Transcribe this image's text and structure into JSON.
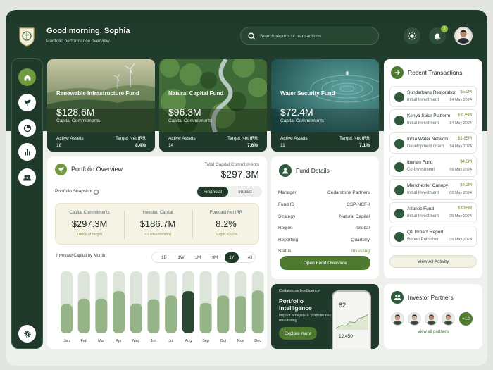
{
  "header": {
    "greeting": "Good morning, Sophia",
    "subtitle": "Portfolio performance overview",
    "search_placeholder": "Search reports or transactions",
    "notification_count": "2"
  },
  "funds": [
    {
      "title": "Renewable Infrastructure Fund",
      "amount": "$128.6M",
      "caption": "Capital Commitments",
      "assets_label": "Active Assets",
      "assets": "18",
      "irr_label": "Target Net IRR",
      "irr": "8.4%"
    },
    {
      "title": "Natural Capital Fund",
      "amount": "$96.3M",
      "caption": "Capital Commitments",
      "assets_label": "Active Assets",
      "assets": "14",
      "irr_label": "Target Net IRR",
      "irr": "7.6%"
    },
    {
      "title": "Water Security Fund",
      "amount": "$72.4M",
      "caption": "Capital Commitments",
      "assets_label": "Active Assets",
      "assets": "11",
      "irr_label": "Target Net IRR",
      "irr": "7.1%"
    }
  ],
  "overview": {
    "title": "Portfolio Overview",
    "total_label": "Total Capital Commitments",
    "total_value": "$297.3M",
    "snapshot_label": "Portfolio Snapshot",
    "toggle": [
      "Financial",
      "Impact"
    ],
    "stats": [
      {
        "label": "Capital Commitments",
        "value": "$297.3M",
        "note": "100% of target"
      },
      {
        "label": "Invested Capital",
        "value": "$186.7M",
        "note": "62.8% invested"
      },
      {
        "label": "Forecast Net IRR",
        "value": "8.2%",
        "note": "Target 8-10%"
      }
    ],
    "chart_title": "Invested Capital by Month",
    "ranges": [
      "1D",
      "1W",
      "1M",
      "3M",
      "1Y",
      "All"
    ],
    "selected_range": "1Y"
  },
  "chart_data": {
    "type": "bar",
    "categories": [
      "Jan",
      "Feb",
      "Mar",
      "Apr",
      "May",
      "Jun",
      "Jul",
      "Aug",
      "Sep",
      "Oct",
      "Nov",
      "Dec"
    ],
    "values": [
      0.47,
      0.56,
      0.56,
      0.68,
      0.48,
      0.55,
      0.61,
      0.68,
      0.49,
      0.61,
      0.6,
      0.69
    ],
    "highlight": "Aug",
    "ylim": [
      0,
      1
    ],
    "colors": {
      "bar": "#95b488",
      "highlight": "#2a4732",
      "track": "#dde4d9"
    }
  },
  "fund_details": {
    "title": "Fund Details",
    "rows": [
      {
        "label": "Manager",
        "value": "Cedarstone Partners"
      },
      {
        "label": "Fund ID",
        "value": "CSP-NCF-I"
      },
      {
        "label": "Strategy",
        "value": "Natural Capital"
      },
      {
        "label": "Region",
        "value": "Global"
      },
      {
        "label": "Reporting",
        "value": "Quarterly"
      },
      {
        "label": "Status",
        "value": "Investing"
      }
    ],
    "button": "Open Fund Overview"
  },
  "promo": {
    "eyebrow": "Cedarstone Intelligence",
    "title": "Portfolio Intelligence",
    "desc": "Impact analysis & portfolio risk monitoring",
    "button": "Explore more",
    "phone_value": "82",
    "phone_value2": "12,450"
  },
  "transactions": {
    "title": "Recent Transactions",
    "items": [
      {
        "name": "Sundarbans Restoration",
        "type": "Initial Investment",
        "amount": "$5.2M",
        "date": "14 May 2024"
      },
      {
        "name": "Kenya Solar Platform",
        "type": "Initial Investment",
        "amount": "$3.75M",
        "date": "14 May 2024"
      },
      {
        "name": "India Water Network",
        "type": "Development Grant",
        "amount": "$1.85M",
        "date": "14 May 2024"
      },
      {
        "name": "Iberian Fund",
        "type": "Co-Investment",
        "amount": "$4.0M",
        "date": "06 May 2024"
      },
      {
        "name": "Manchester Canopy",
        "type": "Initial Investment",
        "amount": "$4.2M",
        "date": "05 May 2024"
      },
      {
        "name": "Atlantic Fund",
        "type": "Initial Investment",
        "amount": "$3.85M",
        "date": "05 May 2024"
      },
      {
        "name": "Q1 Impact Report",
        "type": "Report Published",
        "amount": "",
        "date": "05 May 2024"
      }
    ],
    "button": "View All Activity"
  },
  "partners": {
    "title": "Investor Partners",
    "more": "+12",
    "link": "View all partners"
  },
  "icons": [
    "home-icon",
    "leaf-icon",
    "pie-chart-icon",
    "bar-chart-icon",
    "users-icon",
    "settings-icon",
    "sun-icon",
    "bell-icon",
    "search-icon",
    "arrow-right-icon",
    "info-icon"
  ]
}
